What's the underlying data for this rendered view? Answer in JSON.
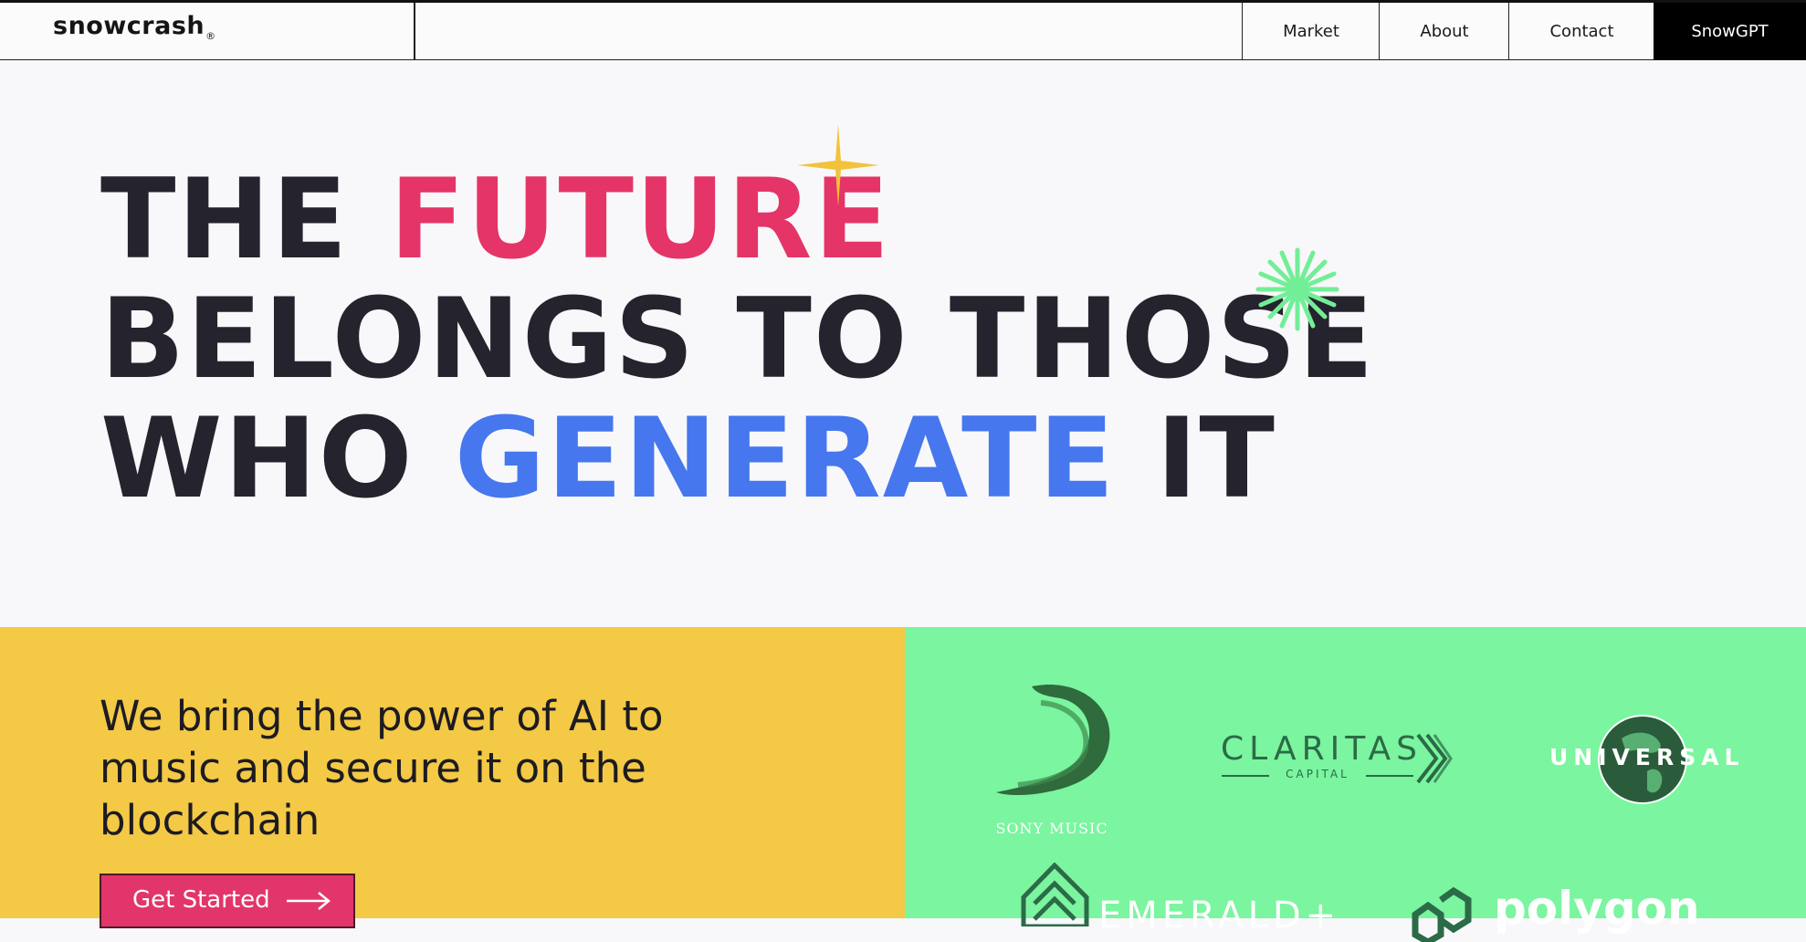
{
  "nav": {
    "logo": "snowcrash",
    "logo_mark": "®",
    "items": [
      {
        "label": "Market"
      },
      {
        "label": "About"
      },
      {
        "label": "Contact"
      },
      {
        "label": "SnowGPT"
      }
    ]
  },
  "hero": {
    "line1_a": "THE ",
    "line1_b": "FUTURE",
    "line2": "BELONGS TO THOSE",
    "line3_a": "WHO ",
    "line3_b": "GENERATE",
    "line3_c": " IT",
    "colors": {
      "pink": "#e53467",
      "blue": "#4677ee",
      "gold_sparkle": "#f2c33a",
      "green_burst": "#72ee97"
    }
  },
  "intro": {
    "tagline": "We bring the power of AI to music and secure it on the blockchain",
    "cta_label": "Get Started",
    "panel_color": "#f3c946"
  },
  "partners": {
    "panel_color": "#7bf59f",
    "sony": "SONY MUSIC",
    "claritas": "CLARITAS",
    "claritas_sub": "CAPITAL",
    "universal": "UNIVERSAL",
    "emerald": "EMERALD+",
    "polygon": "polygon"
  }
}
